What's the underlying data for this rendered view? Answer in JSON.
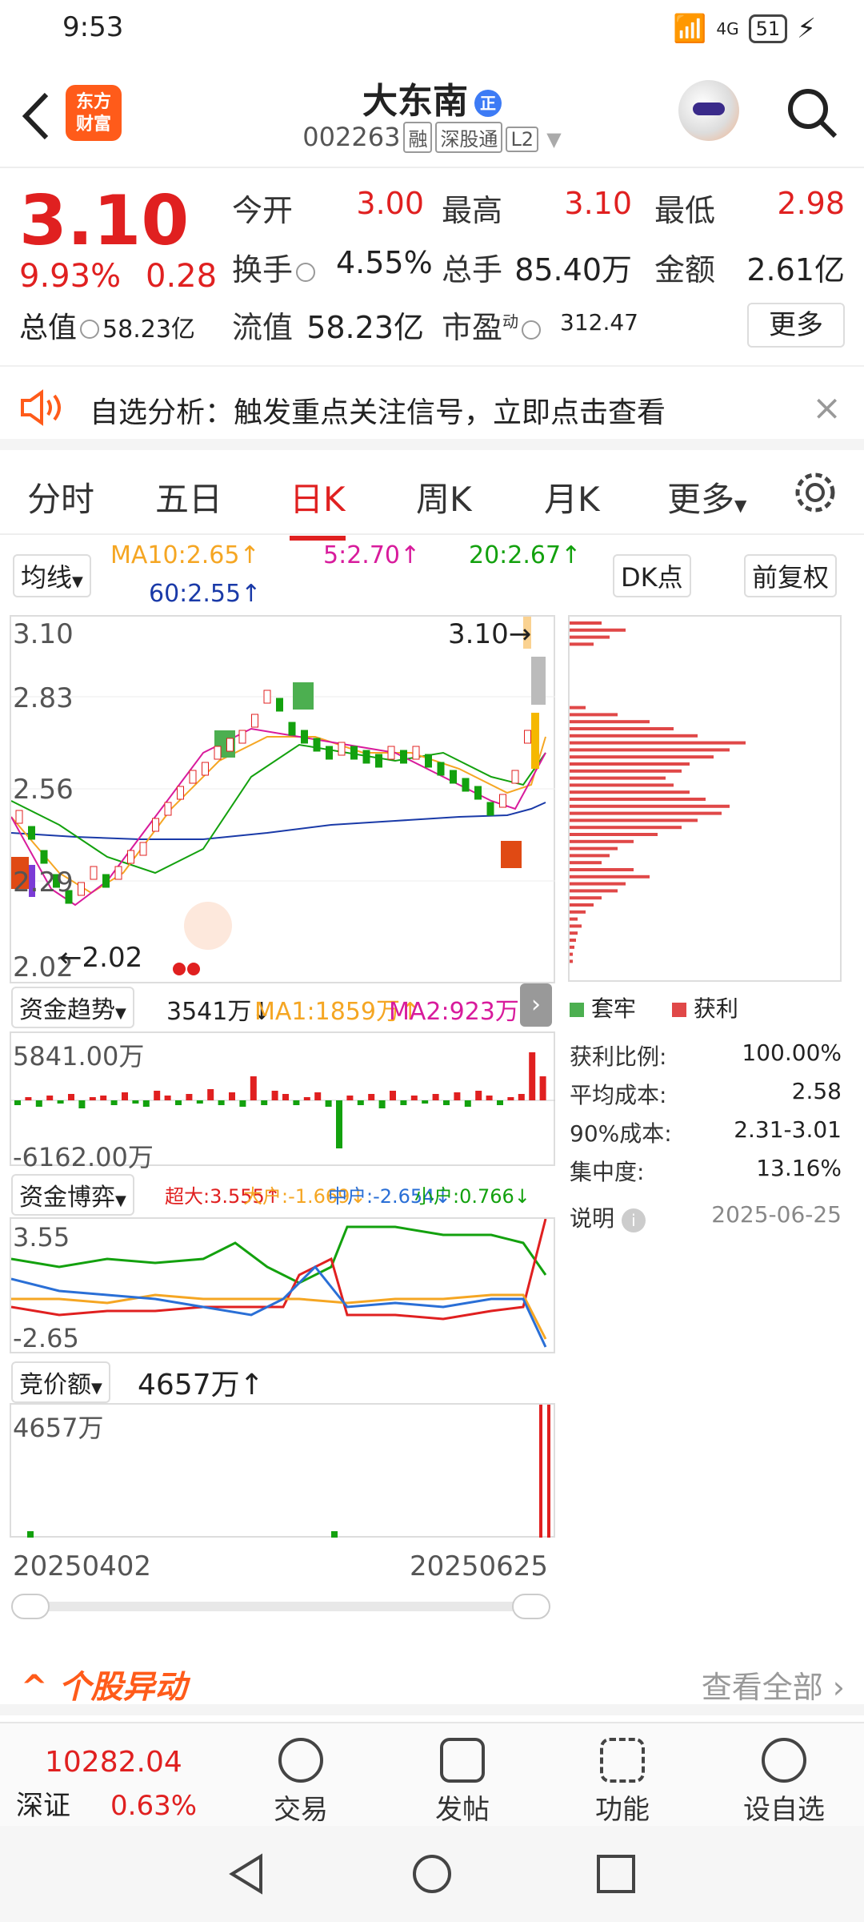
{
  "status": {
    "time": "9:53",
    "net": "4G",
    "battery": "51"
  },
  "header": {
    "logo": "东方\n财富",
    "name": "大东南",
    "badge": "正",
    "code": "002263",
    "tags": [
      "融",
      "深股通",
      "L2"
    ]
  },
  "quote": {
    "price": "3.10",
    "pct": "9.93%",
    "chg": "0.28",
    "total_value_label": "总值",
    "total_value": "58.23亿",
    "open_label": "今开",
    "open": "3.00",
    "high_label": "最高",
    "high": "3.10",
    "low_label": "最低",
    "low": "2.98",
    "turnover_label": "换手",
    "turnover": "4.55%",
    "volume_label": "总手",
    "volume": "85.40万",
    "amount_label": "金额",
    "amount": "2.61亿",
    "float_label": "流值",
    "float": "58.23亿",
    "pe_label": "市盈",
    "pe_sup": "动",
    "pe": "312.47",
    "more": "更多"
  },
  "alert": {
    "text": "自选分析：触发重点关注信号，立即点击查看",
    "close": "×"
  },
  "tabs": [
    "分时",
    "五日",
    "日K",
    "周K",
    "月K",
    "更多"
  ],
  "active_tab": "日K",
  "ma": {
    "selector": "均线",
    "ma10": "MA10:2.65↑",
    "ma5": "5:2.70↑",
    "ma20": "20:2.67↑",
    "ma60": "60:2.55↑",
    "dk": "DK点",
    "fq": "前复权",
    "colors": {
      "ma10": "#f5a623",
      "ma5": "#d81b9c",
      "ma20": "#13a10e",
      "ma60": "#1a3aa8"
    }
  },
  "kline": {
    "yticks": [
      "3.10",
      "2.83",
      "2.56",
      "2.29",
      "2.02"
    ],
    "high_mark": "3.10",
    "low_mark": "2.02"
  },
  "cost": {
    "legend_trapped": "套牢",
    "legend_profit": "获利",
    "rows": [
      {
        "label": "获利比例:",
        "value": "100.00%"
      },
      {
        "label": "平均成本:",
        "value": "2.58"
      },
      {
        "label": "90%成本:",
        "value": "2.31-3.01"
      },
      {
        "label": "集中度:",
        "value": "13.16%"
      }
    ],
    "note_label": "说明",
    "date": "2025-06-25"
  },
  "fund_trend": {
    "selector": "资金趋势",
    "value": "3541万↓",
    "ma1": "MA1:1859万↑",
    "ma2": "MA2:923万↑",
    "ymax": "5841.00万",
    "ymin": "-6162.00万"
  },
  "fund_game": {
    "selector": "资金博弈",
    "super": "超大:3.555↑",
    "big": "大户:-1.669↓",
    "mid": "中户:-2.654↓",
    "small": "小户:0.766↓",
    "ymax": "3.55",
    "ymin": "-2.65"
  },
  "auction": {
    "selector": "竞价额",
    "value": "4657万↑",
    "ymax": "4657万"
  },
  "dates": {
    "start": "20250402",
    "end": "20250625"
  },
  "section": {
    "title": "个股异动",
    "link": "查看全部"
  },
  "bottom": {
    "index_value": "10282.04",
    "index_name": "深证",
    "index_pct": "0.63%",
    "items": [
      "交易",
      "发帖",
      "功能",
      "设自选"
    ]
  }
}
